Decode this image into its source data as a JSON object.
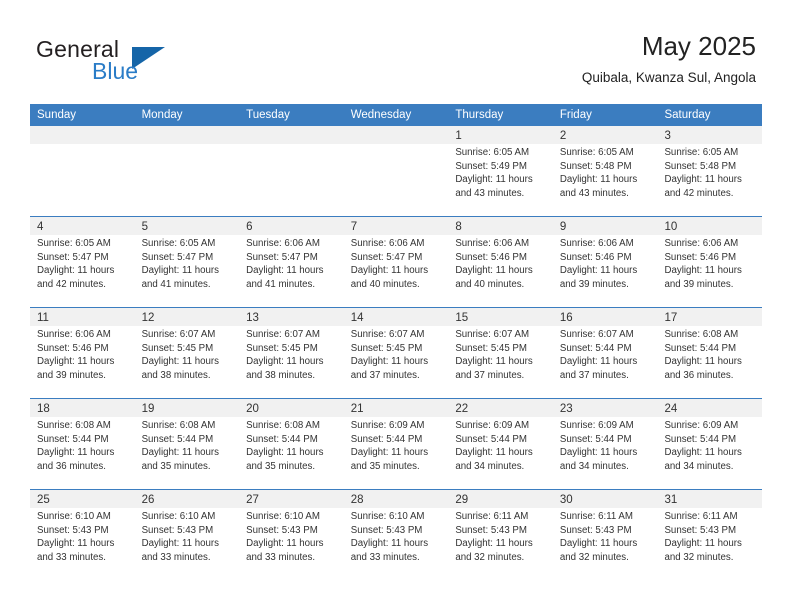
{
  "logo": {
    "word_top": "General",
    "word_bottom": "Blue",
    "triangle_color": "#1565a8",
    "blue_color": "#2a7cc7"
  },
  "header": {
    "title": "May 2025",
    "subtitle": "Quibala, Kwanza Sul, Angola"
  },
  "calendar": {
    "header_bg": "#3b7dc0",
    "daynum_bg": "#f1f1f1",
    "weekdays": [
      "Sunday",
      "Monday",
      "Tuesday",
      "Wednesday",
      "Thursday",
      "Friday",
      "Saturday"
    ],
    "weeks": [
      [
        {
          "day": "",
          "empty": true
        },
        {
          "day": "",
          "empty": true
        },
        {
          "day": "",
          "empty": true
        },
        {
          "day": "",
          "empty": true
        },
        {
          "day": "1",
          "sunrise": "Sunrise: 6:05 AM",
          "sunset": "Sunset: 5:49 PM",
          "daylight1": "Daylight: 11 hours",
          "daylight2": "and 43 minutes."
        },
        {
          "day": "2",
          "sunrise": "Sunrise: 6:05 AM",
          "sunset": "Sunset: 5:48 PM",
          "daylight1": "Daylight: 11 hours",
          "daylight2": "and 43 minutes."
        },
        {
          "day": "3",
          "sunrise": "Sunrise: 6:05 AM",
          "sunset": "Sunset: 5:48 PM",
          "daylight1": "Daylight: 11 hours",
          "daylight2": "and 42 minutes."
        }
      ],
      [
        {
          "day": "4",
          "sunrise": "Sunrise: 6:05 AM",
          "sunset": "Sunset: 5:47 PM",
          "daylight1": "Daylight: 11 hours",
          "daylight2": "and 42 minutes."
        },
        {
          "day": "5",
          "sunrise": "Sunrise: 6:05 AM",
          "sunset": "Sunset: 5:47 PM",
          "daylight1": "Daylight: 11 hours",
          "daylight2": "and 41 minutes."
        },
        {
          "day": "6",
          "sunrise": "Sunrise: 6:06 AM",
          "sunset": "Sunset: 5:47 PM",
          "daylight1": "Daylight: 11 hours",
          "daylight2": "and 41 minutes."
        },
        {
          "day": "7",
          "sunrise": "Sunrise: 6:06 AM",
          "sunset": "Sunset: 5:47 PM",
          "daylight1": "Daylight: 11 hours",
          "daylight2": "and 40 minutes."
        },
        {
          "day": "8",
          "sunrise": "Sunrise: 6:06 AM",
          "sunset": "Sunset: 5:46 PM",
          "daylight1": "Daylight: 11 hours",
          "daylight2": "and 40 minutes."
        },
        {
          "day": "9",
          "sunrise": "Sunrise: 6:06 AM",
          "sunset": "Sunset: 5:46 PM",
          "daylight1": "Daylight: 11 hours",
          "daylight2": "and 39 minutes."
        },
        {
          "day": "10",
          "sunrise": "Sunrise: 6:06 AM",
          "sunset": "Sunset: 5:46 PM",
          "daylight1": "Daylight: 11 hours",
          "daylight2": "and 39 minutes."
        }
      ],
      [
        {
          "day": "11",
          "sunrise": "Sunrise: 6:06 AM",
          "sunset": "Sunset: 5:46 PM",
          "daylight1": "Daylight: 11 hours",
          "daylight2": "and 39 minutes."
        },
        {
          "day": "12",
          "sunrise": "Sunrise: 6:07 AM",
          "sunset": "Sunset: 5:45 PM",
          "daylight1": "Daylight: 11 hours",
          "daylight2": "and 38 minutes."
        },
        {
          "day": "13",
          "sunrise": "Sunrise: 6:07 AM",
          "sunset": "Sunset: 5:45 PM",
          "daylight1": "Daylight: 11 hours",
          "daylight2": "and 38 minutes."
        },
        {
          "day": "14",
          "sunrise": "Sunrise: 6:07 AM",
          "sunset": "Sunset: 5:45 PM",
          "daylight1": "Daylight: 11 hours",
          "daylight2": "and 37 minutes."
        },
        {
          "day": "15",
          "sunrise": "Sunrise: 6:07 AM",
          "sunset": "Sunset: 5:45 PM",
          "daylight1": "Daylight: 11 hours",
          "daylight2": "and 37 minutes."
        },
        {
          "day": "16",
          "sunrise": "Sunrise: 6:07 AM",
          "sunset": "Sunset: 5:44 PM",
          "daylight1": "Daylight: 11 hours",
          "daylight2": "and 37 minutes."
        },
        {
          "day": "17",
          "sunrise": "Sunrise: 6:08 AM",
          "sunset": "Sunset: 5:44 PM",
          "daylight1": "Daylight: 11 hours",
          "daylight2": "and 36 minutes."
        }
      ],
      [
        {
          "day": "18",
          "sunrise": "Sunrise: 6:08 AM",
          "sunset": "Sunset: 5:44 PM",
          "daylight1": "Daylight: 11 hours",
          "daylight2": "and 36 minutes."
        },
        {
          "day": "19",
          "sunrise": "Sunrise: 6:08 AM",
          "sunset": "Sunset: 5:44 PM",
          "daylight1": "Daylight: 11 hours",
          "daylight2": "and 35 minutes."
        },
        {
          "day": "20",
          "sunrise": "Sunrise: 6:08 AM",
          "sunset": "Sunset: 5:44 PM",
          "daylight1": "Daylight: 11 hours",
          "daylight2": "and 35 minutes."
        },
        {
          "day": "21",
          "sunrise": "Sunrise: 6:09 AM",
          "sunset": "Sunset: 5:44 PM",
          "daylight1": "Daylight: 11 hours",
          "daylight2": "and 35 minutes."
        },
        {
          "day": "22",
          "sunrise": "Sunrise: 6:09 AM",
          "sunset": "Sunset: 5:44 PM",
          "daylight1": "Daylight: 11 hours",
          "daylight2": "and 34 minutes."
        },
        {
          "day": "23",
          "sunrise": "Sunrise: 6:09 AM",
          "sunset": "Sunset: 5:44 PM",
          "daylight1": "Daylight: 11 hours",
          "daylight2": "and 34 minutes."
        },
        {
          "day": "24",
          "sunrise": "Sunrise: 6:09 AM",
          "sunset": "Sunset: 5:44 PM",
          "daylight1": "Daylight: 11 hours",
          "daylight2": "and 34 minutes."
        }
      ],
      [
        {
          "day": "25",
          "sunrise": "Sunrise: 6:10 AM",
          "sunset": "Sunset: 5:43 PM",
          "daylight1": "Daylight: 11 hours",
          "daylight2": "and 33 minutes."
        },
        {
          "day": "26",
          "sunrise": "Sunrise: 6:10 AM",
          "sunset": "Sunset: 5:43 PM",
          "daylight1": "Daylight: 11 hours",
          "daylight2": "and 33 minutes."
        },
        {
          "day": "27",
          "sunrise": "Sunrise: 6:10 AM",
          "sunset": "Sunset: 5:43 PM",
          "daylight1": "Daylight: 11 hours",
          "daylight2": "and 33 minutes."
        },
        {
          "day": "28",
          "sunrise": "Sunrise: 6:10 AM",
          "sunset": "Sunset: 5:43 PM",
          "daylight1": "Daylight: 11 hours",
          "daylight2": "and 33 minutes."
        },
        {
          "day": "29",
          "sunrise": "Sunrise: 6:11 AM",
          "sunset": "Sunset: 5:43 PM",
          "daylight1": "Daylight: 11 hours",
          "daylight2": "and 32 minutes."
        },
        {
          "day": "30",
          "sunrise": "Sunrise: 6:11 AM",
          "sunset": "Sunset: 5:43 PM",
          "daylight1": "Daylight: 11 hours",
          "daylight2": "and 32 minutes."
        },
        {
          "day": "31",
          "sunrise": "Sunrise: 6:11 AM",
          "sunset": "Sunset: 5:43 PM",
          "daylight1": "Daylight: 11 hours",
          "daylight2": "and 32 minutes."
        }
      ]
    ]
  }
}
